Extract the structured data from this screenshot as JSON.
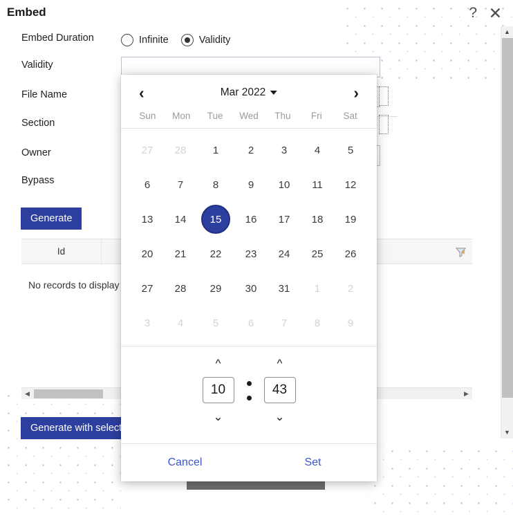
{
  "page": {
    "title": "Embed",
    "help_icon": "question-mark-icon",
    "close_icon": "close-icon"
  },
  "form": {
    "labels": {
      "embed_duration": "Embed Duration",
      "validity": "Validity",
      "file_name": "File Name",
      "section": "Section",
      "owner": "Owner",
      "bypass": "Bypass"
    },
    "duration_options": [
      {
        "label": "Infinite",
        "checked": false
      },
      {
        "label": "Validity",
        "checked": true
      }
    ],
    "inputs": {
      "validity_value": "",
      "file_name_value": "",
      "owner_value": ""
    }
  },
  "buttons": {
    "generate": "Generate",
    "generate_with_selected": "Generate with selected",
    "accent_color": "#2c3e9e"
  },
  "grid": {
    "columns": [
      "Id"
    ],
    "empty_message": "No records to display",
    "filter_icon": "funnel-filter-icon"
  },
  "scrollbar": {
    "up_arrow_icon": "chevron-up-icon",
    "down_arrow_icon": "chevron-down-icon",
    "left_arrow_icon": "chevron-left-icon",
    "right_arrow_icon": "chevron-right-icon"
  },
  "datetime_picker": {
    "prev_icon": "chevron-left-icon",
    "next_icon": "chevron-right-icon",
    "month_label": "Mar 2022",
    "weekdays": [
      "Sun",
      "Mon",
      "Tue",
      "Wed",
      "Thu",
      "Fri",
      "Sat"
    ],
    "days": [
      {
        "n": "27",
        "muted": true
      },
      {
        "n": "28",
        "muted": true
      },
      {
        "n": "1"
      },
      {
        "n": "2"
      },
      {
        "n": "3"
      },
      {
        "n": "4"
      },
      {
        "n": "5"
      },
      {
        "n": "6"
      },
      {
        "n": "7"
      },
      {
        "n": "8"
      },
      {
        "n": "9"
      },
      {
        "n": "10"
      },
      {
        "n": "11"
      },
      {
        "n": "12"
      },
      {
        "n": "13"
      },
      {
        "n": "14"
      },
      {
        "n": "15",
        "selected": true
      },
      {
        "n": "16"
      },
      {
        "n": "17"
      },
      {
        "n": "18"
      },
      {
        "n": "19"
      },
      {
        "n": "20"
      },
      {
        "n": "21"
      },
      {
        "n": "22"
      },
      {
        "n": "23"
      },
      {
        "n": "24"
      },
      {
        "n": "25"
      },
      {
        "n": "26"
      },
      {
        "n": "27"
      },
      {
        "n": "28"
      },
      {
        "n": "29"
      },
      {
        "n": "30"
      },
      {
        "n": "31"
      },
      {
        "n": "1",
        "muted": true
      },
      {
        "n": "2",
        "muted": true
      },
      {
        "n": "3",
        "muted": true
      },
      {
        "n": "4",
        "muted": true
      },
      {
        "n": "5",
        "muted": true
      },
      {
        "n": "6",
        "muted": true
      },
      {
        "n": "7",
        "muted": true
      },
      {
        "n": "8",
        "muted": true
      },
      {
        "n": "9",
        "muted": true
      }
    ],
    "selected_day": "15",
    "time": {
      "hour": "10",
      "minute": "43",
      "separator": ":",
      "hour_up_icon": "chevron-up-icon",
      "hour_down_icon": "chevron-down-icon",
      "minute_up_icon": "chevron-up-icon",
      "minute_down_icon": "chevron-down-icon"
    },
    "actions": {
      "cancel": "Cancel",
      "set": "Set"
    },
    "link_color": "#3c56c7",
    "selection_color": "#2c3e9e"
  }
}
